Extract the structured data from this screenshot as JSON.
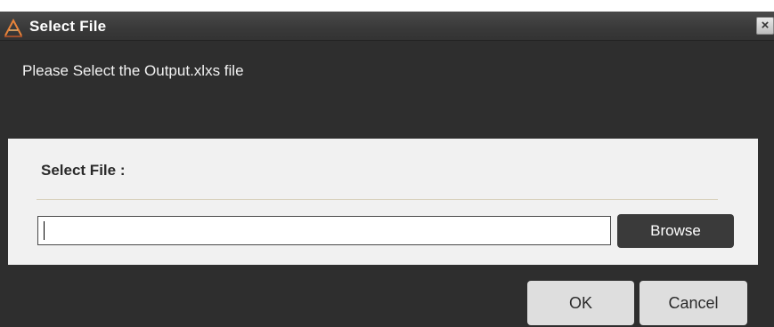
{
  "window": {
    "title": "Select File",
    "icon": "app-logo-icon",
    "close_label": "×"
  },
  "message": "Please Select the Output.xlxs file",
  "panel": {
    "label": "Select File :",
    "input_value": "",
    "input_placeholder": "",
    "browse_label": "Browse"
  },
  "footer": {
    "ok_label": "OK",
    "cancel_label": "Cancel"
  },
  "colors": {
    "dialog_bg": "#2e2e2e",
    "panel_bg": "#f1f1f1",
    "button_dark": "#3a3a3a",
    "button_light": "#dedede",
    "logo_accent": "#e8833a"
  }
}
